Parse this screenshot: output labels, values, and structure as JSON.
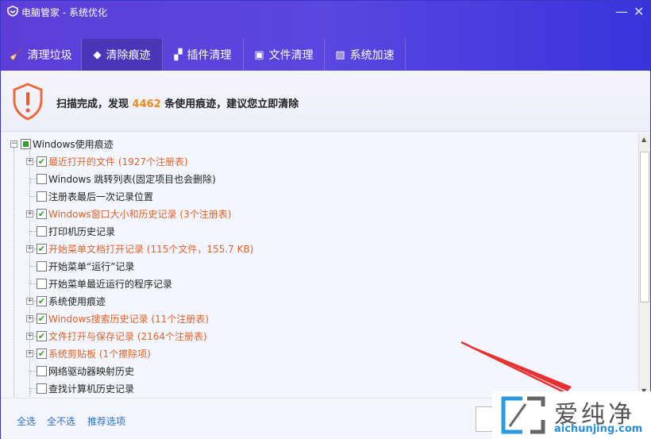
{
  "window": {
    "title": "电脑管家 - 系统优化",
    "minimize_icon": "minimize-icon",
    "close_icon": "close-icon"
  },
  "tabs": [
    {
      "label": "清理垃圾",
      "icon": "broom-icon",
      "glyph": "🧹"
    },
    {
      "label": "清除痕迹",
      "icon": "eraser-icon",
      "glyph": "◆"
    },
    {
      "label": "插件清理",
      "icon": "plugin-icon",
      "glyph": "▞"
    },
    {
      "label": "文件清理",
      "icon": "trash-icon",
      "glyph": "▣"
    },
    {
      "label": "系统加速",
      "icon": "monitor-icon",
      "glyph": "▨"
    }
  ],
  "banner": {
    "prefix": "扫描完成，发现 ",
    "count": "4462",
    "suffix": " 条使用痕迹，建议您立即清除"
  },
  "tree": {
    "root": {
      "label": "Windows使用痕迹",
      "state": "partial"
    },
    "items": [
      {
        "label": "最近打开的文件 (1927个注册表)",
        "checked": true,
        "expandable": true,
        "highlight": true
      },
      {
        "label": "Windows 跳转列表(固定项目也会删除)",
        "checked": false,
        "expandable": false,
        "highlight": false
      },
      {
        "label": "注册表最后一次记录位置",
        "checked": false,
        "expandable": false,
        "highlight": false
      },
      {
        "label": "Windows窗口大小和历史记录 (3个注册表)",
        "checked": true,
        "expandable": true,
        "highlight": true
      },
      {
        "label": "打印机历史记录",
        "checked": false,
        "expandable": false,
        "highlight": false
      },
      {
        "label": "开始菜单文档打开记录 (115个文件，155.7 KB)",
        "checked": true,
        "expandable": true,
        "highlight": true
      },
      {
        "label": "开始菜单“运行”记录",
        "checked": false,
        "expandable": false,
        "highlight": false
      },
      {
        "label": "开始菜单最近运行的程序记录",
        "checked": false,
        "expandable": false,
        "highlight": false
      },
      {
        "label": "系统使用痕迹",
        "checked": true,
        "expandable": true,
        "highlight": false
      },
      {
        "label": "Windows搜索历史记录 (11个注册表)",
        "checked": true,
        "expandable": true,
        "highlight": true
      },
      {
        "label": "文件打开与保存记录 (2164个注册表)",
        "checked": true,
        "expandable": true,
        "highlight": true
      },
      {
        "label": "系统剪贴板 (1个擦除项)",
        "checked": true,
        "expandable": true,
        "highlight": true
      },
      {
        "label": "网络驱动器映射历史",
        "checked": false,
        "expandable": false,
        "highlight": false
      },
      {
        "label": "查找计算机历史记录",
        "checked": false,
        "expandable": false,
        "highlight": false
      }
    ]
  },
  "footer": {
    "select_all": "全选",
    "select_none": "全不选",
    "recommended": "推荐选项"
  },
  "watermark": {
    "text": "爱纯净",
    "url": "aichunjing.com"
  },
  "colors": {
    "header": "#5a47e0",
    "highlight": "#e0622a",
    "count": "#f08a1c",
    "link": "#2a6fc9"
  }
}
